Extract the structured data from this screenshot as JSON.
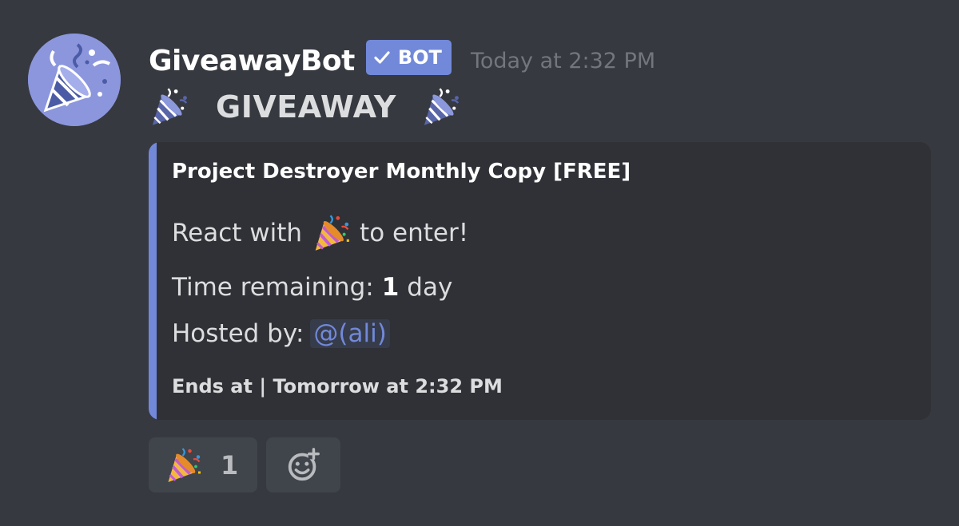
{
  "message": {
    "username": "GiveawayBot",
    "bot_tag": "BOT",
    "timestamp": "Today at 2:32 PM",
    "headline": "GIVEAWAY",
    "avatar_icon": "party-popper-icon"
  },
  "embed": {
    "accent_color": "#7289da",
    "title": "Project Destroyer Monthly Copy [FREE]",
    "react_prefix": "React with",
    "react_suffix": "to enter!",
    "time_label": "Time remaining:",
    "time_value": "1",
    "time_unit": "day",
    "hosted_label": "Hosted by:",
    "host_mention": "@(ali)",
    "footer": "Ends at | Tomorrow at 2:32 PM"
  },
  "reactions": [
    {
      "emoji": "party-popper-icon",
      "count": "1"
    }
  ],
  "add_reaction_icon": "add-reaction-icon",
  "colors": {
    "background": "#36393f",
    "embed_background": "#2f3136",
    "mention": "#7289da",
    "timestamp": "#72767d"
  }
}
